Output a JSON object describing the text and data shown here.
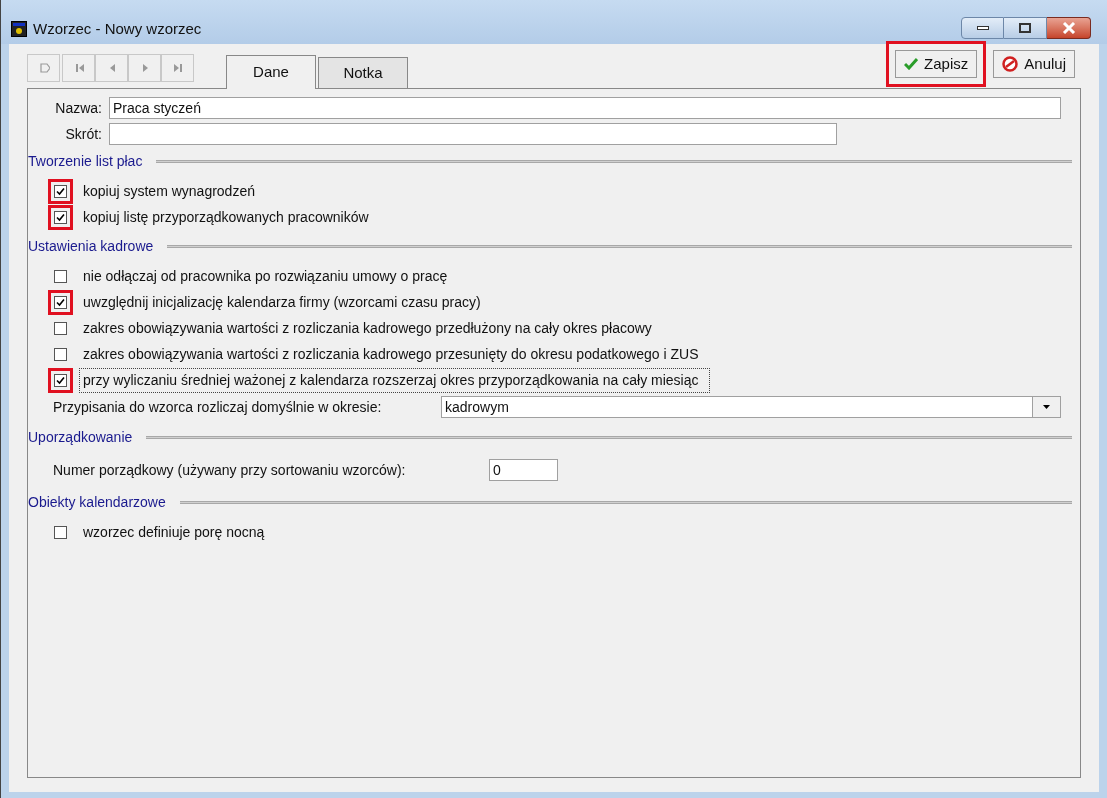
{
  "window": {
    "title": "Wzorzec - Nowy wzorzec"
  },
  "tabs": [
    {
      "label": "Dane",
      "selected": true
    },
    {
      "label": "Notka",
      "selected": false
    }
  ],
  "buttons": [
    {
      "kind": "save",
      "label": "Zapisz",
      "highlighted": true
    },
    {
      "kind": "cancel",
      "label": "Anuluj",
      "highlighted": false
    }
  ],
  "fields": [
    {
      "label": "Nazwa:",
      "value": "Praca styczeń"
    },
    {
      "label": "Skrót:"
    }
  ],
  "sections": [
    {
      "title": "Tworzenie list płac",
      "items": [
        {
          "kind": "checkbox",
          "label": "kopiuj system wynagrodzeń",
          "checked": true,
          "highlighted": true,
          "focused": false
        },
        {
          "kind": "checkbox",
          "label": "kopiuj listę przyporządkowanych pracowników",
          "checked": true,
          "highlighted": true,
          "focused": false
        }
      ]
    },
    {
      "title": "Ustawienia kadrowe",
      "items": [
        {
          "kind": "checkbox",
          "label": "nie odłączaj od pracownika po rozwiązaniu umowy o pracę",
          "checked": false,
          "highlighted": false,
          "focused": false
        },
        {
          "kind": "checkbox",
          "label": "uwzględnij inicjalizację kalendarza firmy (wzorcami czasu pracy)",
          "checked": true,
          "highlighted": true,
          "focused": false
        },
        {
          "kind": "checkbox",
          "label": "zakres obowiązywania wartości z rozliczania kadrowego przedłużony na cały okres płacowy",
          "checked": false,
          "highlighted": false,
          "focused": false
        },
        {
          "kind": "checkbox",
          "label": "zakres obowiązywania wartości z rozliczania kadrowego przesunięty do okresu podatkowego i ZUS",
          "checked": false,
          "highlighted": false,
          "focused": false
        },
        {
          "kind": "checkbox",
          "label": "przy wyliczaniu średniej ważonej z kalendarza rozszerzaj okres przyporządkowania na cały miesiąc",
          "checked": true,
          "highlighted": true,
          "focused": true
        },
        {
          "kind": "dropdown",
          "label": "Przypisania do wzorca rozliczaj domyślnie w okresie:",
          "value": "kadrowym"
        }
      ]
    },
    {
      "title": "Uporządkowanie",
      "items": [
        {
          "kind": "number",
          "label": "Numer porządkowy (używany przy sortowaniu wzorców):",
          "value": "0"
        }
      ]
    },
    {
      "title": "Obiekty kalendarzowe",
      "items": [
        {
          "kind": "checkbox",
          "label": "wzorzec definiuje porę nocną",
          "checked": false,
          "highlighted": false,
          "focused": false
        }
      ]
    }
  ]
}
